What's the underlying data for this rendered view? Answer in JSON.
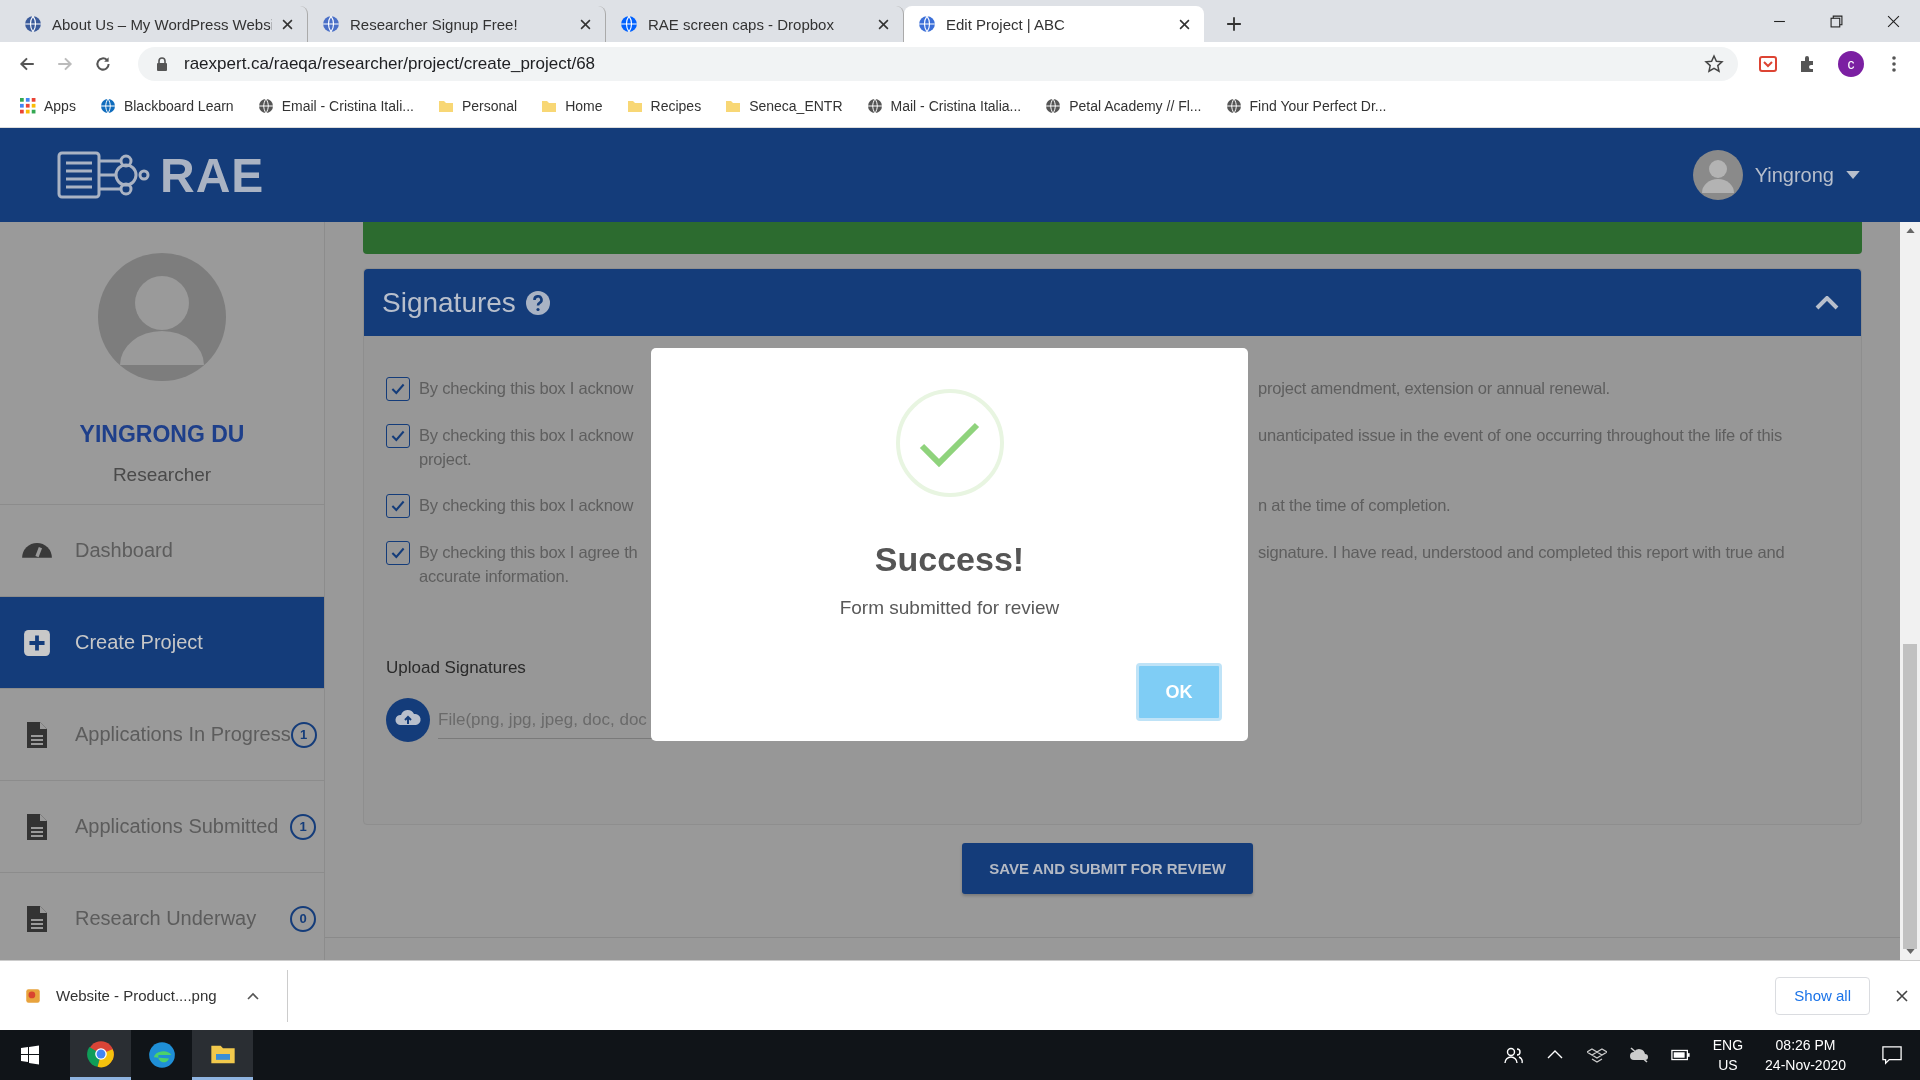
{
  "browser": {
    "tabs": [
      {
        "title": "About Us – My WordPress Websi",
        "selected": false
      },
      {
        "title": "Researcher Signup Free!",
        "selected": false
      },
      {
        "title": "RAE screen caps - Dropbox",
        "selected": false
      },
      {
        "title": "Edit Project | ABC",
        "selected": true
      }
    ],
    "address": "raexpert.ca/raeqa/researcher/project/create_project/68",
    "profile_initial": "c",
    "bookmarks": [
      {
        "label": "Apps",
        "kind": "apps"
      },
      {
        "label": "Blackboard Learn",
        "kind": "site"
      },
      {
        "label": "Email - Cristina Itali...",
        "kind": "site"
      },
      {
        "label": "Personal",
        "kind": "folder"
      },
      {
        "label": "Home",
        "kind": "folder"
      },
      {
        "label": "Recipes",
        "kind": "folder"
      },
      {
        "label": "Seneca_ENTR",
        "kind": "folder"
      },
      {
        "label": "Mail - Cristina Italia...",
        "kind": "site"
      },
      {
        "label": "Petal Academy // Fl...",
        "kind": "site"
      },
      {
        "label": "Find Your Perfect Dr...",
        "kind": "site"
      }
    ]
  },
  "header": {
    "logo_text": "RAE",
    "user_name": "Yingrong"
  },
  "sidebar": {
    "name": "YINGRONG DU",
    "role": "Researcher",
    "items": [
      {
        "label": "Dashboard",
        "selected": false
      },
      {
        "label": "Create Project",
        "selected": true
      },
      {
        "label": "Applications In Progress",
        "selected": false,
        "count": "1"
      },
      {
        "label": "Applications Submitted",
        "selected": false,
        "count": "1"
      },
      {
        "label": "Research Underway",
        "selected": false,
        "count": "0"
      }
    ]
  },
  "signatures": {
    "title": "Signatures",
    "statements": [
      {
        "checked": true,
        "left_lines": [
          "By checking this box I acknow"
        ],
        "right": "project amendment, extension or annual renewal."
      },
      {
        "checked": true,
        "left_lines": [
          "By checking this box I acknow",
          "project."
        ],
        "right": "unanticipated issue in the event of one occurring throughout the life of this"
      },
      {
        "checked": true,
        "left_lines": [
          "By checking this box I acknow"
        ],
        "right": "n at the time of completion."
      },
      {
        "checked": true,
        "left_lines": [
          "By checking this box I agree th",
          "accurate information."
        ],
        "right": "signature. I have read, understood and completed this report with true and"
      }
    ],
    "upload_label": "Upload Signatures",
    "file_placeholder": "File(png, jpg, jpeg, doc, doc"
  },
  "submit_button": "SAVE AND SUBMIT FOR REVIEW",
  "modal": {
    "title": "Success!",
    "message": "Form submitted for review",
    "button": "OK"
  },
  "download_bar": {
    "file": "Website - Product....png",
    "show_all": "Show all"
  },
  "taskbar": {
    "language": "ENG",
    "region": "US",
    "time": "08:26 PM",
    "date": "24-Nov-2020"
  }
}
